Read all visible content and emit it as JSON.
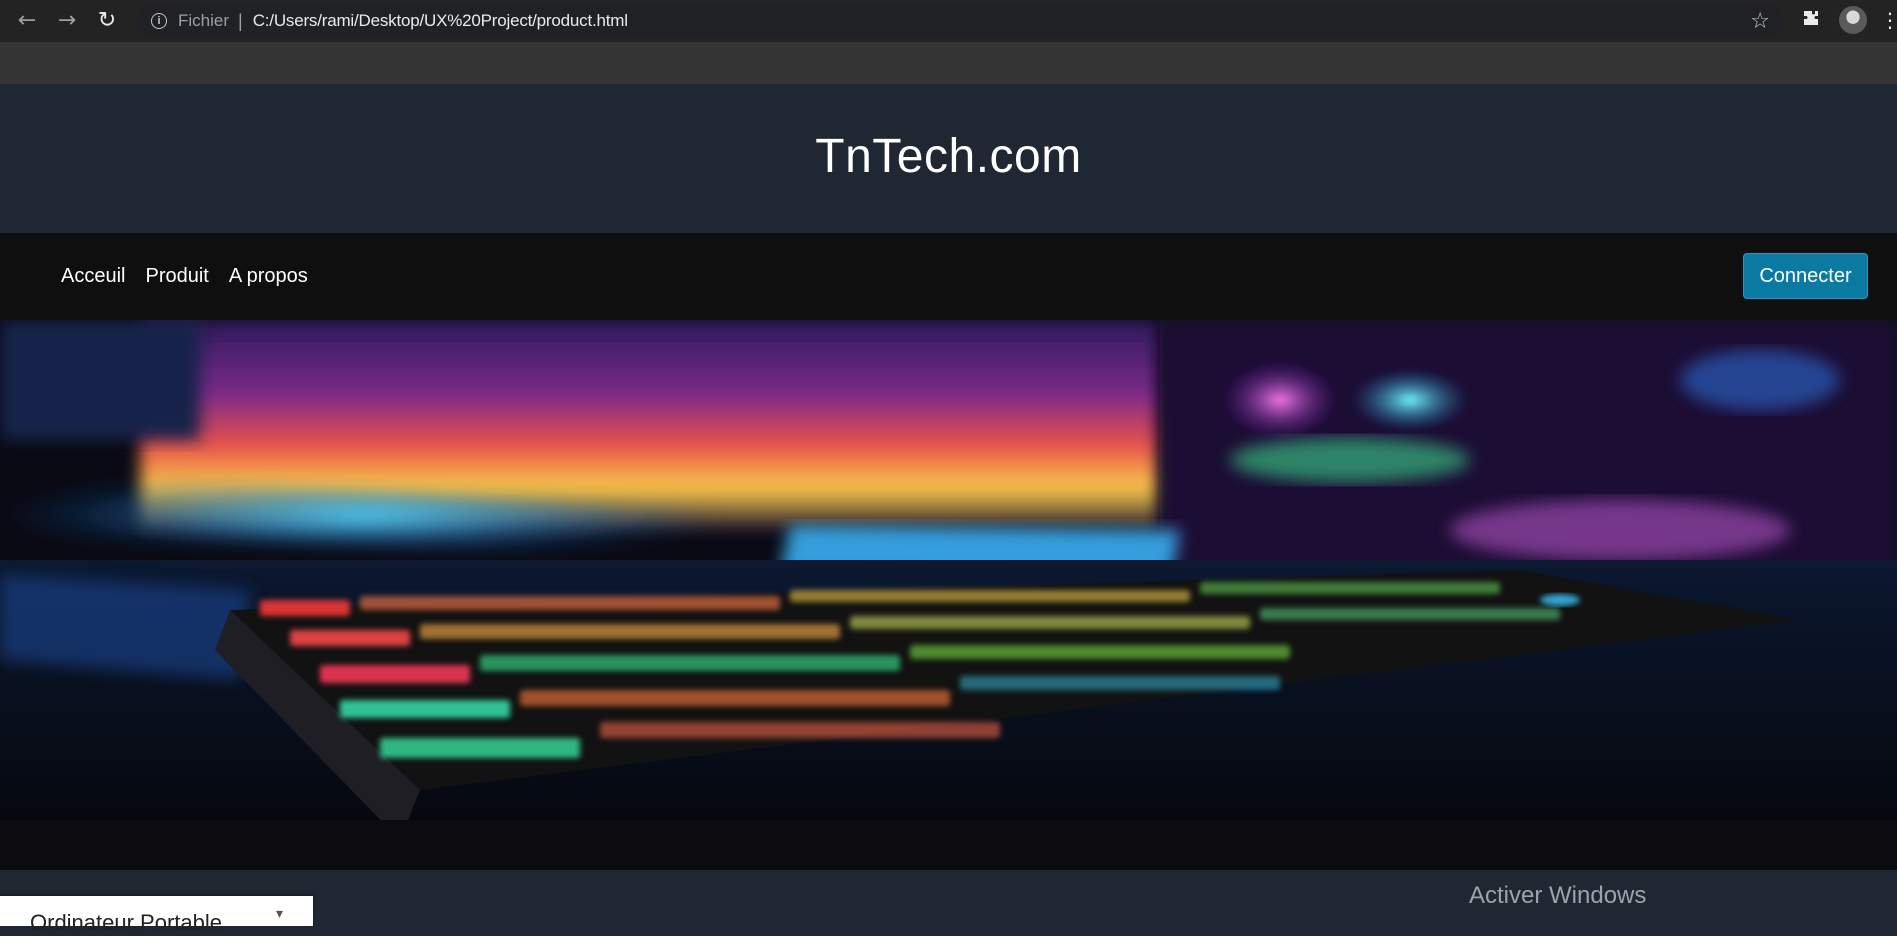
{
  "browser": {
    "back_icon": "arrow-left-icon",
    "forward_icon": "arrow-right-icon",
    "reload_icon": "reload-icon",
    "scheme_label": "Fichier",
    "url": "C:/Users/rami/Desktop/UX%20Project/product.html",
    "star_icon": "star-icon",
    "extensions_icon": "puzzle-icon",
    "menu_icon": "kebab-menu-icon"
  },
  "header": {
    "title": "TnTech.com"
  },
  "nav": {
    "links": [
      "Acceuil",
      "Produit",
      "A propos"
    ],
    "connect_label": "Connecter"
  },
  "footer": {
    "side_panel_text": "Ordinateur Portable",
    "watermark": "Activer Windows"
  },
  "colors": {
    "header_bg": "#1f2732",
    "navbar_bg": "#0f0f0f",
    "accent": "#0a7aa3"
  }
}
